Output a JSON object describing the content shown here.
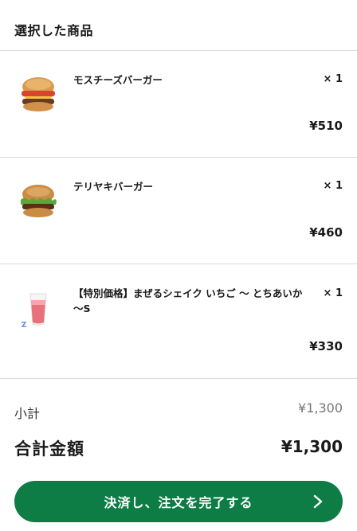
{
  "section": {
    "title": "選択した商品"
  },
  "items": [
    {
      "name": "モスチーズバーガー",
      "qty": "× 1",
      "price": "¥510",
      "icon": "cheeseburger-icon"
    },
    {
      "name": "テリヤキバーガー",
      "qty": "× 1",
      "price": "¥460",
      "icon": "teriyaki-burger-icon"
    },
    {
      "name": "【特別価格】まぜるシェイク いちご ～ とちあいか ～S",
      "qty": "× 1",
      "price": "¥330",
      "icon": "strawberry-shake-icon"
    }
  ],
  "summary": {
    "subtotal_label": "小計",
    "subtotal_value": "¥1,300",
    "total_label": "合計金額",
    "total_value": "¥1,300"
  },
  "checkout": {
    "label": "決済し、注文を完了する",
    "icon": "chevron-right-icon"
  },
  "colors": {
    "accent": "#0e7c45",
    "divider": "#d9d9d9"
  }
}
